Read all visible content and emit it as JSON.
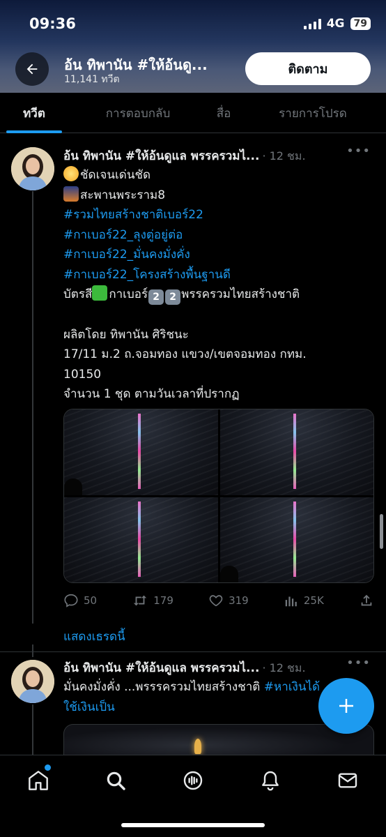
{
  "status_bar": {
    "time": "09:36",
    "network": "4G",
    "battery": "79"
  },
  "header": {
    "title": "อ้น ทิพานัน #ให้อ้นดู...",
    "subtitle": "11,141 ทวีต",
    "follow_label": "ติดตาม"
  },
  "tabs": [
    {
      "label": "ทวีต",
      "active": true
    },
    {
      "label": "การตอบกลับ",
      "active": false
    },
    {
      "label": "สื่อ",
      "active": false
    },
    {
      "label": "รายการโปรด",
      "active": false
    }
  ],
  "tweet1": {
    "author": "อ้น ทิพานัน #ให้อ้นดูแล พรรครวมไ...",
    "time": "· 12 ชม.",
    "line1": "ชัดเจนเด่นชัด",
    "line2": "สะพานพระราม8",
    "hashtag1": "#รวมไทยสร้างชาติเบอร์22",
    "hashtag2": "#กาเบอร์22_ลุงตู่อยู่ต่อ",
    "hashtag3": "#กาเบอร์22_มั่นคงมั่งคั่ง",
    "hashtag4": "#กาเบอร์22_โครงสร้างพื้นฐานดี",
    "ballot_prefix": "บัตรสี",
    "ballot_mid": "กาเบอร์",
    "ballot_digit": "2",
    "ballot_suffix": "พรรครวมไทยสร้างชาติ",
    "producer": "ผลิตโดย ทิพานัน ศิริชนะ",
    "address1": "17/11 ม.2 ถ.จอมทอง แขวง/เขตจอมทอง กทม.",
    "address2": "10150",
    "quantity": "จำนวน 1 ชุด ตามวันเวลาที่ปรากฏ",
    "replies": "50",
    "retweets": "179",
    "likes": "319",
    "views": "25K"
  },
  "show_thread": "แสดงเธรดนี้",
  "tweet2": {
    "author": "อ้น ทิพานัน #ให้อ้นดูแล พรรครวมไ...",
    "time": "· 12 ชม.",
    "text": "มั่นคงมั่งคั่ง ...พรรรครวมไทยสร้างชาติ ",
    "hashtag": "#หาเงินได้",
    "line2": "ใช้เงินเป็น"
  },
  "colors": {
    "accent": "#1d9bf0",
    "background": "#000000",
    "muted": "#71767b"
  }
}
